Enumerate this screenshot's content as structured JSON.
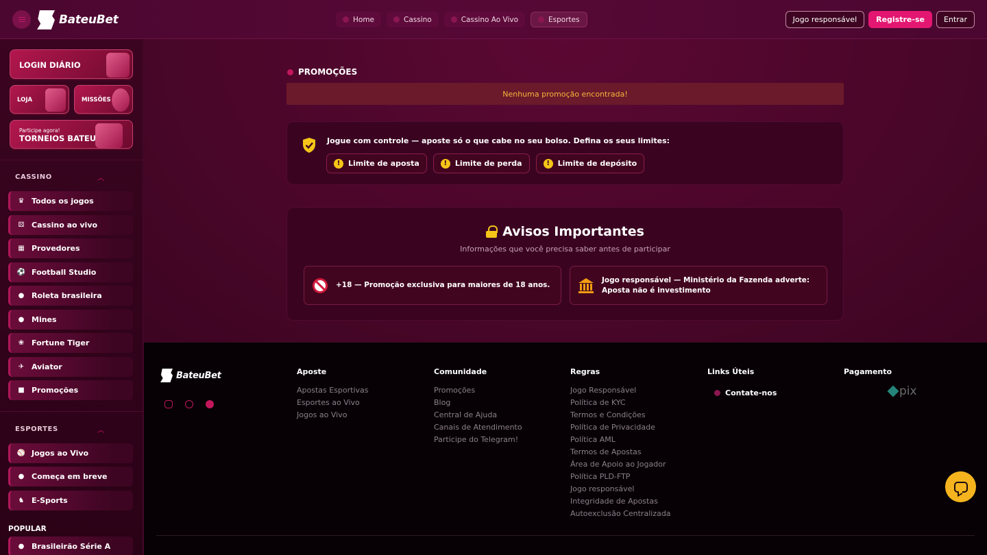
{
  "header": {
    "brand": "BateuBet",
    "nav": [
      {
        "label": "Home"
      },
      {
        "label": "Cassino"
      },
      {
        "label": "Cassino Ao Vivo"
      },
      {
        "label": "Esportes"
      }
    ],
    "responsible_label": "Jogo responsável",
    "register_label": "Registre-se",
    "login_label": "Entrar"
  },
  "sidebar": {
    "cards": {
      "daily_login": "LOGIN DIÁRIO",
      "shop": "LOJA",
      "missions": "MISSÕES",
      "tournaments_sub": "Participe agora!",
      "tournaments": "TORNEIOS BATEU"
    },
    "casino_title": "CASSINO",
    "casino_items": [
      {
        "label": "Todos os jogos",
        "icon": "crown-icon"
      },
      {
        "label": "Cassino ao vivo",
        "icon": "dice-icon"
      },
      {
        "label": "Provedores",
        "icon": "grid-icon"
      },
      {
        "label": "Football Studio",
        "icon": "soccer-ball-icon"
      },
      {
        "label": "Roleta brasileira",
        "icon": "roulette-icon"
      },
      {
        "label": "Mines",
        "icon": "bomb-icon"
      },
      {
        "label": "Fortune Tiger",
        "icon": "paw-icon"
      },
      {
        "label": "Aviator",
        "icon": "plane-icon"
      },
      {
        "label": "Promoções",
        "icon": "gift-icon"
      }
    ],
    "sports_title": "ESPORTES",
    "sports_items": [
      {
        "label": "Jogos ao Vivo",
        "icon": "live-icon"
      },
      {
        "label": "Começa em breve",
        "icon": "clock-icon"
      },
      {
        "label": "E-Sports",
        "icon": "gamepad-icon"
      }
    ],
    "popular_title": "POPULAR",
    "popular_items": [
      {
        "label": "Brasileirão Série A",
        "icon": "brazil-flag-icon"
      }
    ]
  },
  "main": {
    "promotions_title": "PROMOÇÕES",
    "empty_message": "Nenhuma promoção encontrada!",
    "control_text": "Jogue com controle — aposte só o que cabe no seu bolso. Defina os seus limites:",
    "limits": [
      "Limite de aposta",
      "Limite de perda",
      "Limite de depósito"
    ],
    "notices_title": "Avisos Importantes",
    "notices_subtitle": "Informações que você precisa saber antes de participar",
    "notice_age": "+18 — Promoção exclusiva para maiores de 18 anos.",
    "notice_ministry_line1": "Jogo responsável — Ministério da Fazenda adverte:",
    "notice_ministry_line2": "Aposta não é investimento"
  },
  "footer": {
    "brand": "BateuBet",
    "columns": [
      {
        "title": "Aposte",
        "links": [
          "Apostas Esportivas",
          "Esportes ao Vivo",
          "Jogos ao Vivo"
        ]
      },
      {
        "title": "Comunidade",
        "links": [
          "Promoções",
          "Blog",
          "Central de Ajuda",
          "Canais de Atendimento",
          "Participe do Telegram!"
        ]
      },
      {
        "title": "Regras",
        "links": [
          "Jogo Responsável",
          "Política de KYC",
          "Termos e Condições",
          "Política de Privacidade",
          "Política AML",
          "Termos de Apostas",
          "Área de Apoio ao Jogador",
          "Política PLD-FTP",
          "Jogo responsável",
          "Integridade de Apostas",
          "Autoexclusão Centralizada"
        ]
      }
    ],
    "useful_title": "Links Úteis",
    "contact_label": "Contate-nos",
    "payment_title": "Pagamento",
    "payment_pix": "pix"
  },
  "colors": {
    "accent": "#e31671",
    "background": "#3d0523",
    "warning": "#f5c518"
  }
}
